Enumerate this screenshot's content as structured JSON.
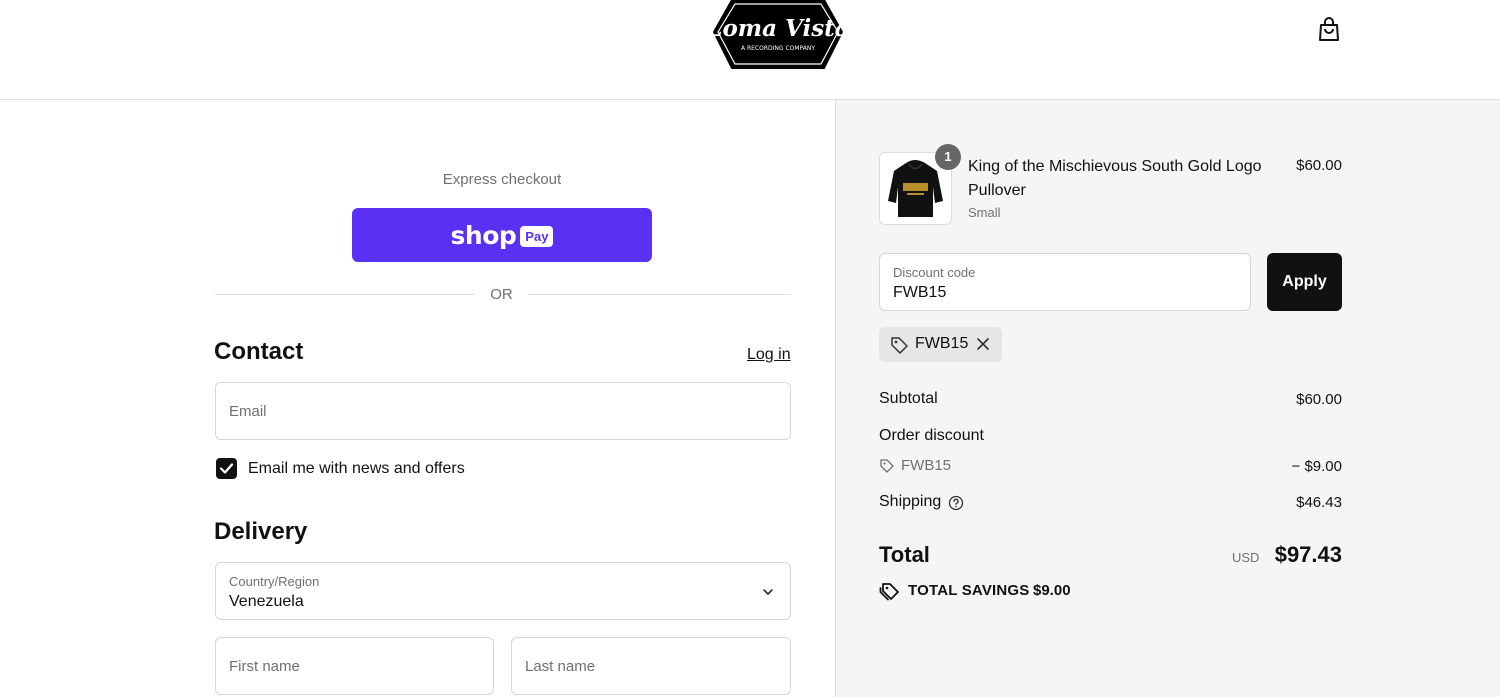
{
  "header": {
    "brand": "Loma Vista",
    "brand_tagline": "A RECORDING COMPANY",
    "cart_icon": "shopping-bag-icon"
  },
  "express": {
    "label": "Express checkout",
    "shop_pay_word": "shop",
    "shop_pay_badge": "Pay",
    "shop_pay_color": "#5a31f4",
    "or_text": "OR"
  },
  "contact": {
    "heading": "Contact",
    "login_link": "Log in",
    "email_placeholder": "Email",
    "newsletter_label": "Email me with news and offers",
    "newsletter_checked": true
  },
  "delivery": {
    "heading": "Delivery",
    "country_label": "Country/Region",
    "country_value": "Venezuela",
    "first_name_placeholder": "First name",
    "last_name_placeholder": "Last name"
  },
  "summary": {
    "item": {
      "quantity": "1",
      "name": "King of the Mischievous South Gold Logo Pullover",
      "variant": "Small",
      "price": "$60.00"
    },
    "discount_field_label": "Discount code",
    "discount_field_value": "FWB15",
    "apply_label": "Apply",
    "applied_code": "FWB15",
    "subtotal_label": "Subtotal",
    "subtotal_value": "$60.00",
    "order_discount_label": "Order discount",
    "order_discount_code": "FWB15",
    "order_discount_value": "− $9.00",
    "shipping_label": "Shipping",
    "shipping_value": "$46.43",
    "total_label": "Total",
    "total_currency": "USD",
    "total_value": "$97.43",
    "savings_label": "TOTAL SAVINGS",
    "savings_value": "$9.00"
  }
}
